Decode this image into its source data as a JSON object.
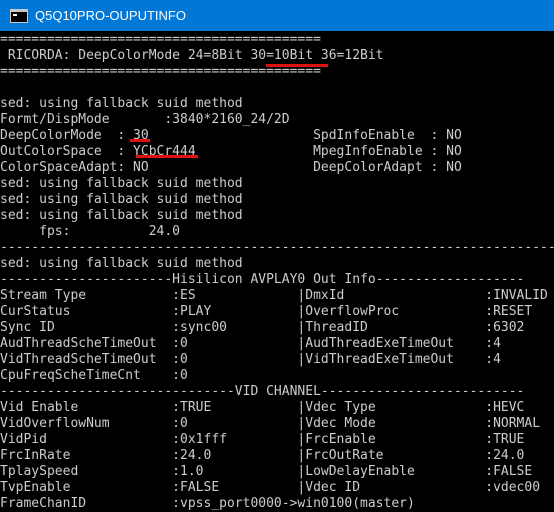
{
  "window": {
    "title": "Q5Q10PRO-OUPUTINFO",
    "icon": "console-window-icon"
  },
  "colors": {
    "titlebar": "#0078d7",
    "background": "#000000",
    "text": "#cccccc",
    "highlight": "#e01010"
  },
  "console": {
    "lines": [
      "=========================================",
      " RICORDA: DeepColorMode 24=8Bit 30=10Bit 36=12Bit",
      "=========================================",
      "",
      "sed: using fallback suid method",
      "Formt/DispMode       :3840*2160_24/2D",
      "DeepColorMode  : 30                     SpdInfoEnable  : NO",
      "OutColorSpace  : YCbCr444               MpegInfoEnable : NO",
      "ColorSpaceAdapt: NO                     DeepColorAdapt : NO",
      "sed: using fallback suid method",
      "sed: using fallback suid method",
      "sed: using fallback suid method",
      "     fps:          24.0",
      "--------------------------------------------------------------------------------",
      "sed: using fallback suid method",
      "----------------------Hisilicon AVPLAY0 Out Info-------------------",
      "Stream Type           :ES             |DmxId                  :INVALID",
      "CurStatus             :PLAY           |OverflowProc           :RESET",
      "Sync ID               :sync00         |ThreadID               :6302",
      "AudThreadScheTimeOut  :0              |AudThreadExeTimeOut    :4",
      "VidThreadScheTimeOut  :0              |VidThreadExeTimeOut    :4",
      "CpuFreqScheTimeCnt    :0",
      "------------------------------VID CHANNEL--------------------------",
      "Vid Enable            :TRUE           |Vdec Type              :HEVC",
      "VidOverflowNum        :0              |Vdec Mode              :NORMAL",
      "VidPid                :0x1fff         |FrcEnable              :TRUE",
      "FrcInRate             :24.0           |FrcOutRate             :24.0",
      "TplaySpeed            :1.0            |LowDelayEnable         :FALSE",
      "TvpEnable             :FALSE          |Vdec ID                :vdec00",
      "FrameChanID           :vpss_port0000->win0100(master)"
    ]
  }
}
